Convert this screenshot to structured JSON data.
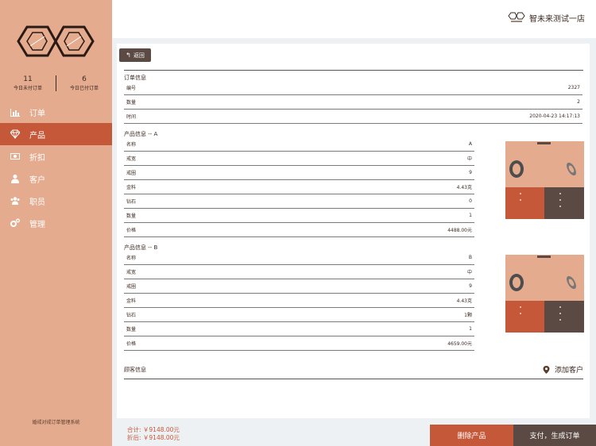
{
  "sidebar": {
    "stats": [
      {
        "value": "11",
        "label": "今日未付订单"
      },
      {
        "value": "6",
        "label": "今日已付订单"
      }
    ],
    "items": [
      {
        "label": "订单",
        "icon": "bar-chart-icon"
      },
      {
        "label": "产品",
        "icon": "diamond-icon"
      },
      {
        "label": "折扣",
        "icon": "money-icon"
      },
      {
        "label": "客户",
        "icon": "user-icon"
      },
      {
        "label": "职员",
        "icon": "users-icon"
      },
      {
        "label": "管理",
        "icon": "gears-icon"
      }
    ],
    "active_index": 1,
    "footer": "婚戒对戒订单管理系统"
  },
  "header": {
    "store_name": "智未来测试一店"
  },
  "back_label": "返回",
  "order": {
    "title": "订单信息",
    "rows": [
      {
        "label": "编号",
        "value": "2327"
      },
      {
        "label": "数量",
        "value": "2"
      },
      {
        "label": "时间",
        "value": "2020-04-23 14:17:13"
      }
    ]
  },
  "products": [
    {
      "title": "产品信息 -- A",
      "rows": [
        {
          "label": "名称",
          "value": "A"
        },
        {
          "label": "戒宽",
          "value": "中"
        },
        {
          "label": "戒圈",
          "value": "9"
        },
        {
          "label": "金料",
          "value": "4.43克"
        },
        {
          "label": "钻石",
          "value": "0"
        },
        {
          "label": "数量",
          "value": "1"
        },
        {
          "label": "价格",
          "value": "4488.00元"
        }
      ]
    },
    {
      "title": "产品信息 -- B",
      "rows": [
        {
          "label": "名称",
          "value": "B"
        },
        {
          "label": "戒宽",
          "value": "中"
        },
        {
          "label": "戒圈",
          "value": "9"
        },
        {
          "label": "金料",
          "value": "4.43克"
        },
        {
          "label": "钻石",
          "value": "1颗"
        },
        {
          "label": "数量",
          "value": "1"
        },
        {
          "label": "价格",
          "value": "4659.00元"
        }
      ]
    }
  ],
  "customer": {
    "title": "顾客信息",
    "add_label": "添加客户"
  },
  "totals": {
    "total": "合计: ￥9148.00元",
    "discounted": "折后: ￥9148.00元"
  },
  "buttons": {
    "delete": "删除产品",
    "pay": "支付，生成订单"
  },
  "colors": {
    "sidebar": "#e4ab8e",
    "accent": "#c6583a",
    "dark": "#5b4a43"
  }
}
